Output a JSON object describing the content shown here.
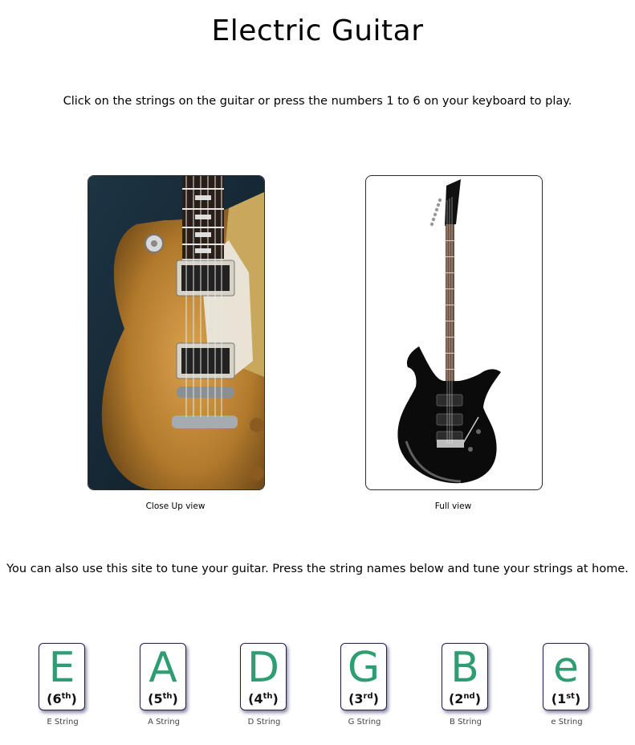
{
  "page": {
    "title": "Electric Guitar",
    "instructions": "Click on the strings on the guitar or press the numbers 1 to 6 on your keyboard to play.",
    "tune_text": "You can also use this site to tune your guitar. Press the string names below and tune your strings at home."
  },
  "views": [
    {
      "caption": "Close Up view"
    },
    {
      "caption": "Full view"
    }
  ],
  "strings": [
    {
      "letter": "E",
      "number": "6",
      "suffix": "th",
      "name": "E String"
    },
    {
      "letter": "A",
      "number": "5",
      "suffix": "th",
      "name": "A String"
    },
    {
      "letter": "D",
      "number": "4",
      "suffix": "th",
      "name": "D String"
    },
    {
      "letter": "G",
      "number": "3",
      "suffix": "rd",
      "name": "G String"
    },
    {
      "letter": "B",
      "number": "2",
      "suffix": "nd",
      "name": "B String"
    },
    {
      "letter": "e",
      "number": "1",
      "suffix": "st",
      "name": "e String"
    }
  ],
  "colors": {
    "accent": "#2e9e72",
    "key_border": "#1f1f4a"
  }
}
